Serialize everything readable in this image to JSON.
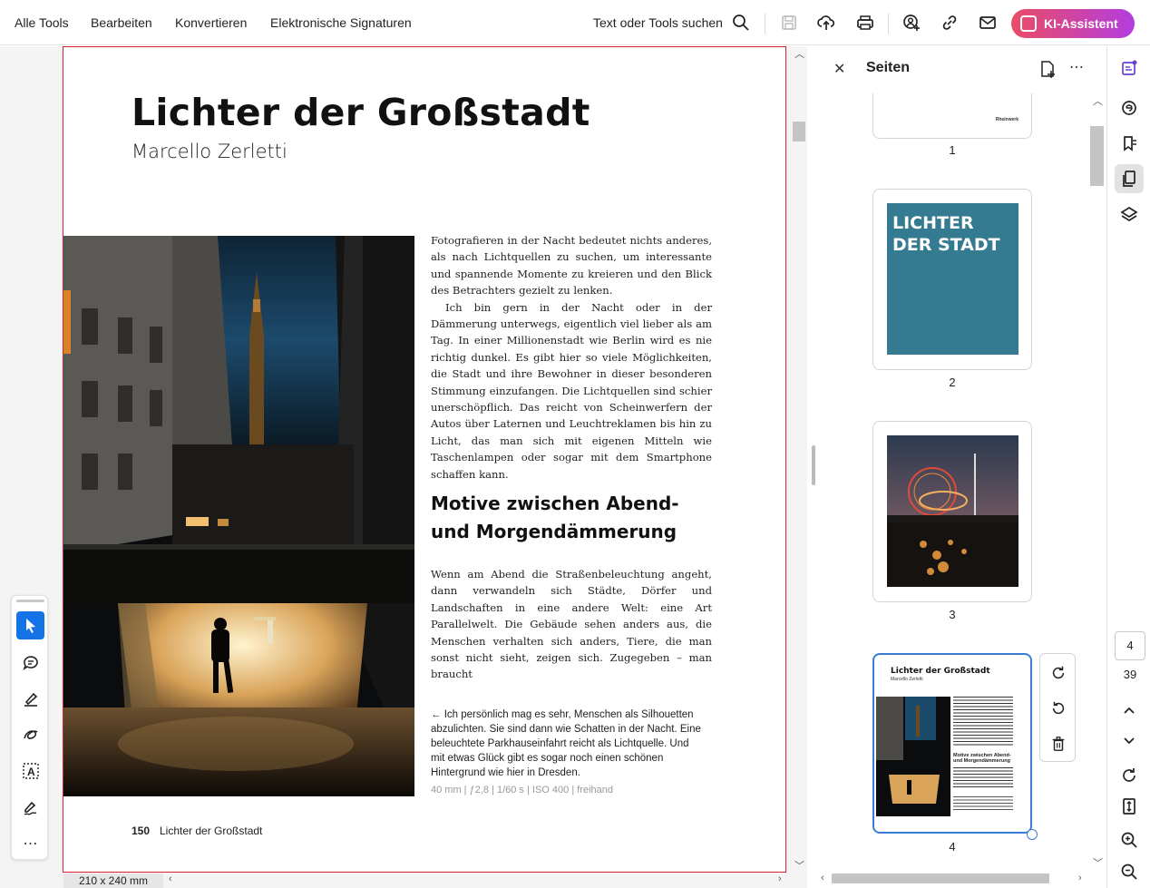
{
  "menubar": {
    "items": [
      "Alle Tools",
      "Bearbeiten",
      "Konvertieren",
      "Elektronische Signaturen"
    ],
    "search_label": "Text oder Tools suchen",
    "ki_button": "KI-Assistent",
    "icons": [
      "search-icon",
      "save-icon",
      "upload-icon",
      "print-icon",
      "share-user-icon",
      "link-icon",
      "mail-icon"
    ]
  },
  "page": {
    "title": "Lichter der Großstadt",
    "author": "Marcello Zerletti",
    "para1": "Fotografieren in der Nacht bedeutet nichts anderes, als nach Lichtquellen zu suchen, um interessante und span­nende Momente zu kreieren und den Blick des Betrachters gezielt zu lenken.",
    "para2": "Ich bin gern in der Nacht oder in der Dämmerung unter­wegs, eigentlich viel lieber als am Tag. In einer Millionen­stadt wie Berlin wird es nie richtig dunkel. Es gibt hier so viele Möglichkeiten, die Stadt und ihre Bewohner in dieser besonderen Stimmung einzufangen. Die Lichtquellen sind schier unerschöpflich. Das reicht von Scheinwerfern der Autos über Laternen und Leuchtreklamen bis hin zu Licht, das man sich mit eigenen Mitteln wie Taschenlampen oder sogar mit dem Smartphone schaffen kann.",
    "subhead": "Motive zwischen Abend- und Morgendämmerung",
    "para3": "Wenn am Abend die Straßenbeleuchtung angeht, dann ver­wandeln sich Städte, Dörfer und Landschaften in eine an­dere Welt: eine Art Parallelwelt. Die Gebäude sehen anders aus, die Menschen verhalten sich anders, Tiere, die man sonst nicht sieht, zeigen sich. Zugegeben – man braucht",
    "caption_arrow": "←",
    "caption": "Ich persönlich mag es sehr, Menschen als Silhouet­ten abzulichten. Sie sind dann wie Schatten in der Nacht. Eine beleuchtete Parkhauseinfahrt reicht als Lichtquelle. Und mit etwas Glück gibt es sogar noch einen schönen Hintergrund wie hier in Dresden.",
    "exif": "40 mm | ƒ2,8 | 1/60 s | ISO 400 | freihand",
    "footer_num": "150",
    "footer_text": "Lichter der Großstadt"
  },
  "status": {
    "page_size": "210 x 240 mm"
  },
  "panel": {
    "title": "Seiten",
    "thumbnails": [
      {
        "num": "1",
        "logo_text": "Rheinwerk"
      },
      {
        "num": "2",
        "cover_text_line1": "LICHTER",
        "cover_text_line2": "DER STADT",
        "cover_color": "#347a91"
      },
      {
        "num": "3"
      },
      {
        "num": "4",
        "mini_title": "Lichter der Großstadt",
        "mini_author": "Marcello Zerletti",
        "mini_subhead": "Motive zwischen Abend- und Morgendämmerung"
      }
    ]
  },
  "navigation": {
    "current_page": "4",
    "total_pages": "39"
  },
  "colors": {
    "accent": "#1473e6",
    "page_border": "#d9232f",
    "ki_gradient_start": "#ea4c64",
    "ki_gradient_end": "#b33de0"
  }
}
